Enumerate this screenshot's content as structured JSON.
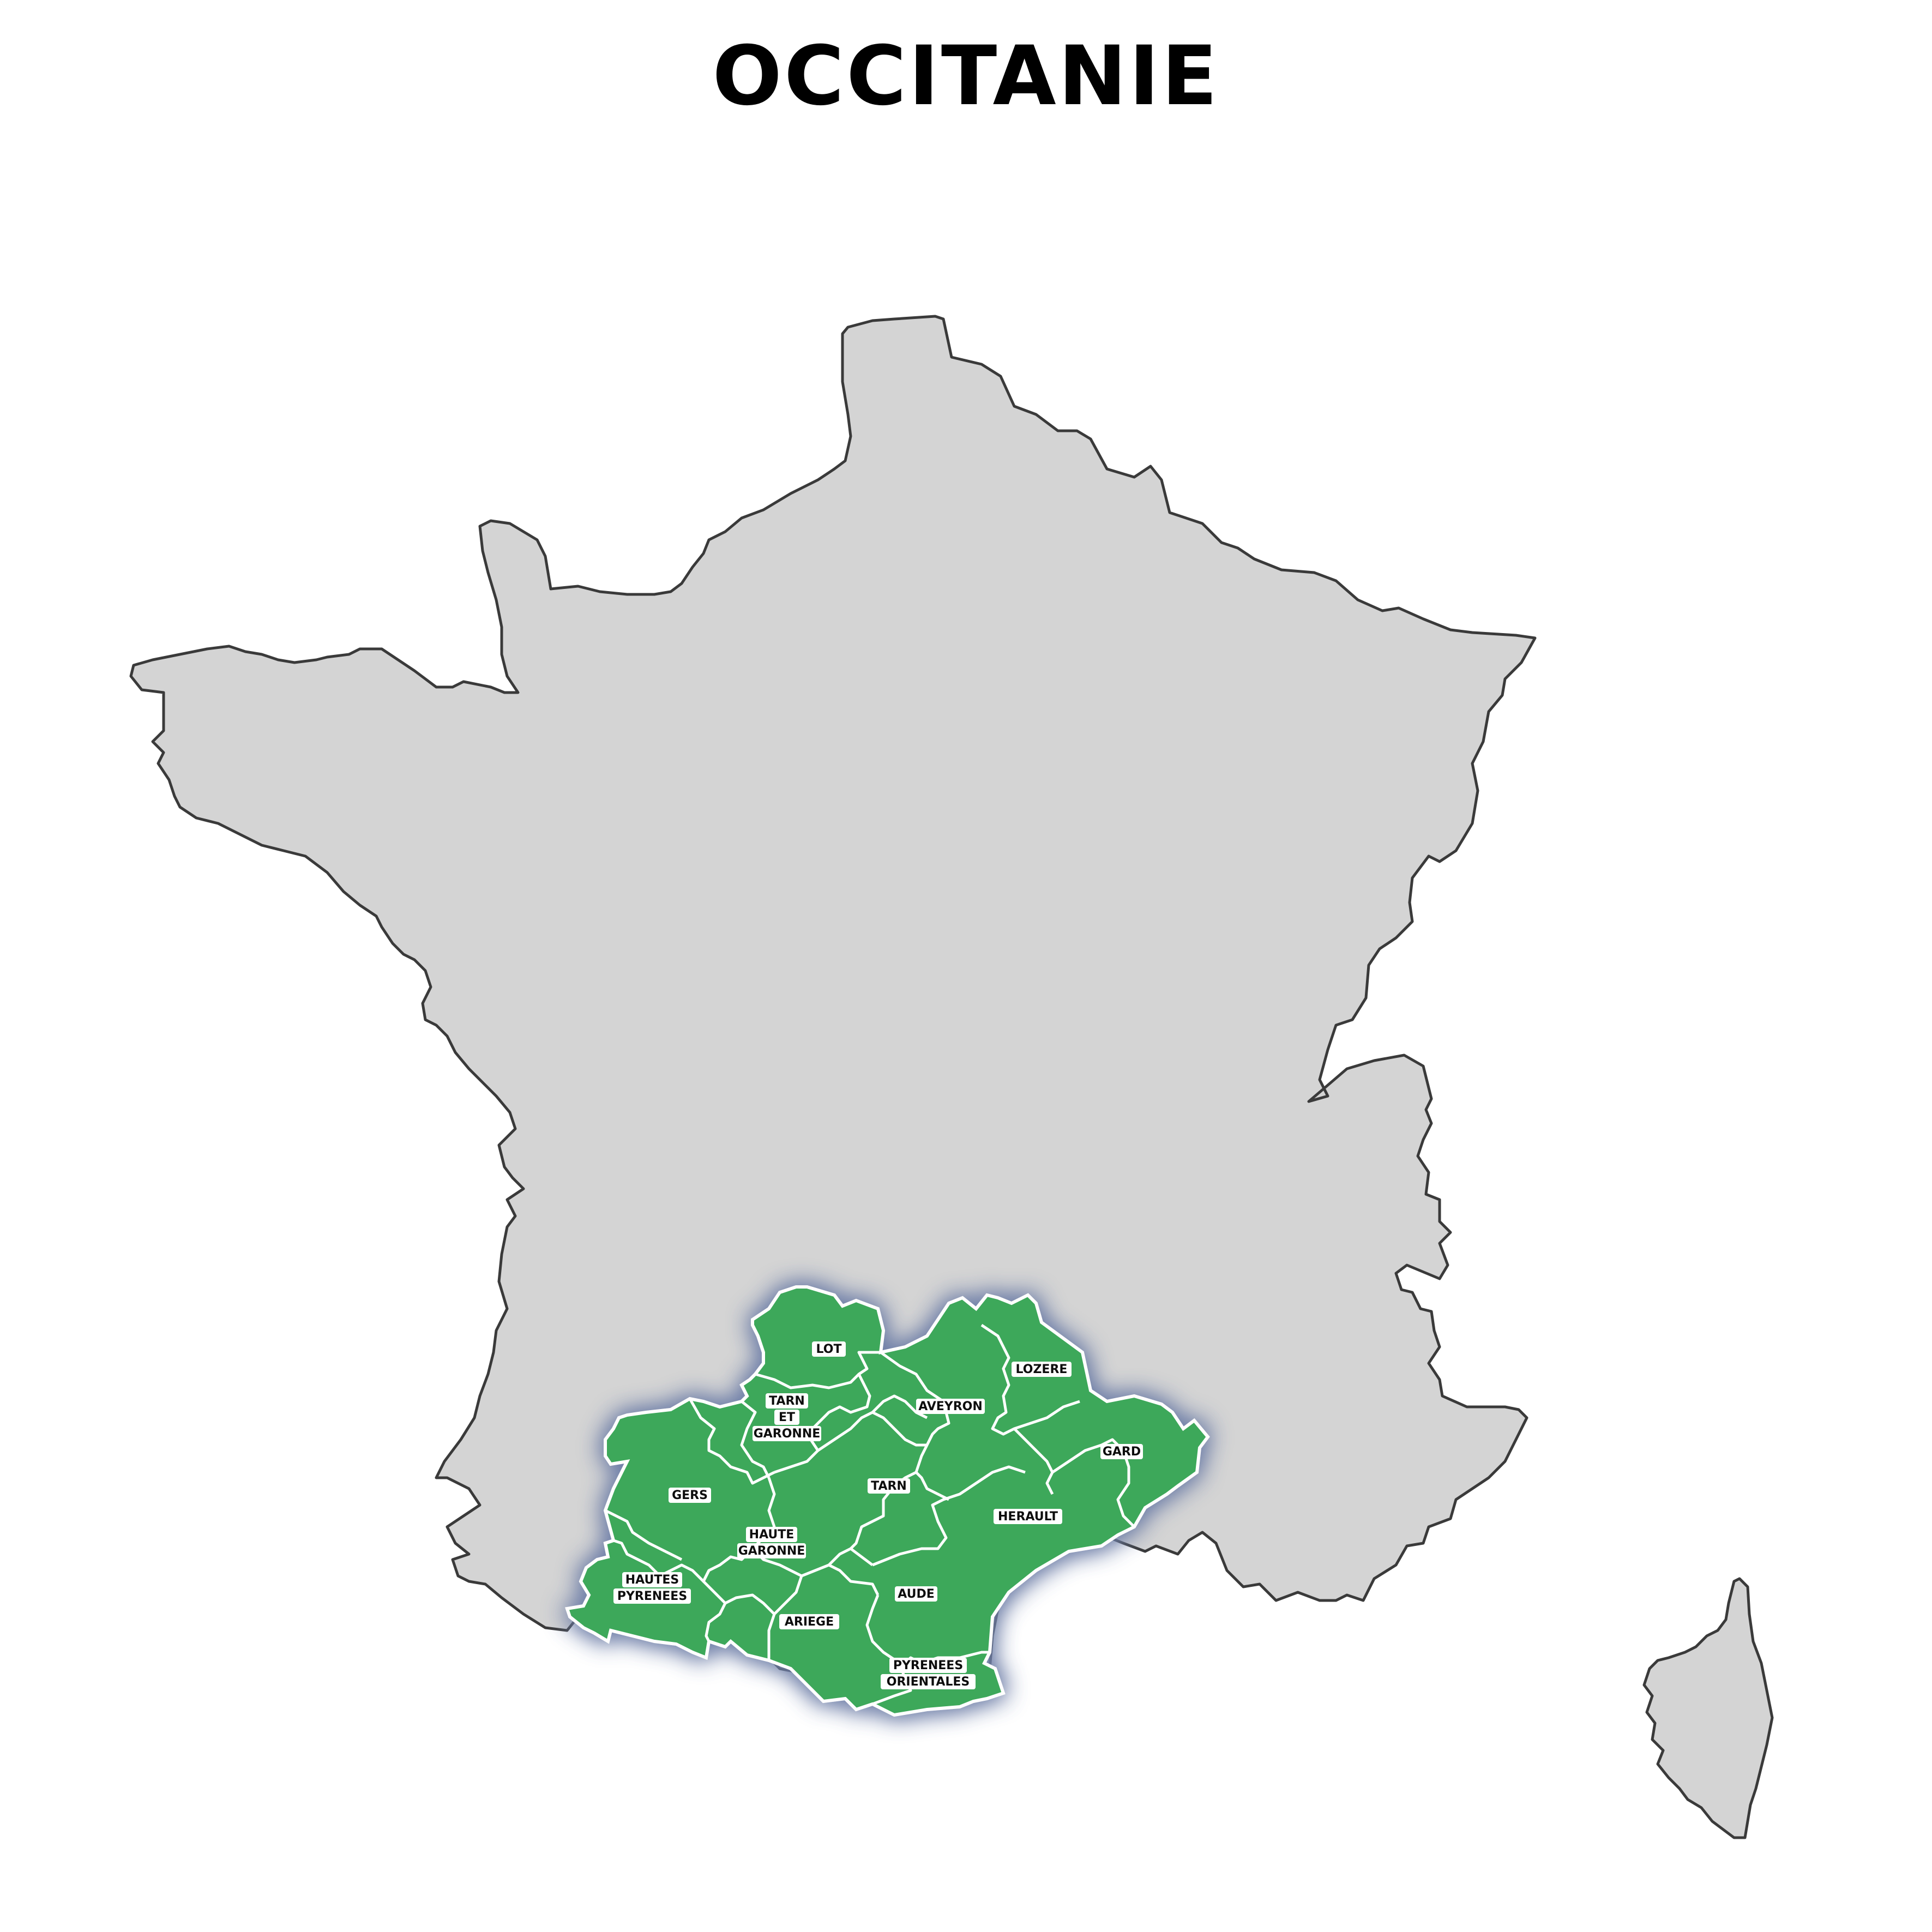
{
  "title": "OCCITANIE",
  "colors": {
    "background": "#ffffff",
    "country_fill": "#d4d4d4",
    "country_outline": "#3a3a3a",
    "region_fill": "#3da85a",
    "region_border": "#ffffff",
    "region_glow": "#6f7fa8"
  },
  "highlighted_region": "Occitanie",
  "departments": [
    {
      "id": "lot",
      "lines": [
        "LOT"
      ]
    },
    {
      "id": "lozere",
      "lines": [
        "LOZERE"
      ]
    },
    {
      "id": "aveyron",
      "lines": [
        "AVEYRON"
      ]
    },
    {
      "id": "tarn-et-garonne",
      "lines": [
        "TARN",
        "ET",
        "GARONNE"
      ]
    },
    {
      "id": "gard",
      "lines": [
        "GARD"
      ]
    },
    {
      "id": "gers",
      "lines": [
        "GERS"
      ]
    },
    {
      "id": "tarn",
      "lines": [
        "TARN"
      ]
    },
    {
      "id": "herault",
      "lines": [
        "HERAULT"
      ]
    },
    {
      "id": "haute-garonne",
      "lines": [
        "HAUTE",
        "GARONNE"
      ]
    },
    {
      "id": "hautes-pyrenees",
      "lines": [
        "HAUTES",
        "PYRENEES"
      ]
    },
    {
      "id": "aude",
      "lines": [
        "AUDE"
      ]
    },
    {
      "id": "ariege",
      "lines": [
        "ARIEGE"
      ]
    },
    {
      "id": "pyrenees-orientales",
      "lines": [
        "PYRENEES",
        "ORIENTALES"
      ]
    }
  ]
}
